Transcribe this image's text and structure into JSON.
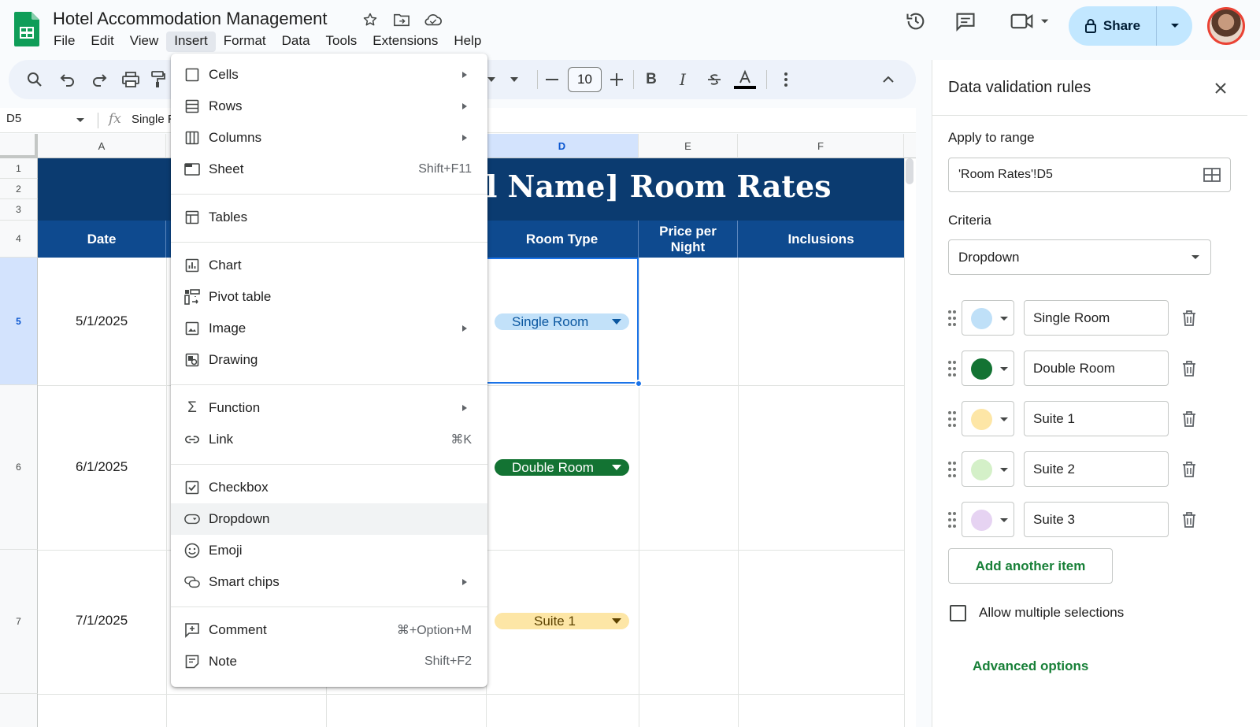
{
  "app": {
    "doc_title": "Hotel Accommodation Management",
    "menus": [
      "File",
      "Edit",
      "View",
      "Insert",
      "Format",
      "Data",
      "Tools",
      "Extensions",
      "Help"
    ],
    "active_menu": "Insert",
    "share_label": "Share"
  },
  "toolbar": {
    "font_size": "10",
    "icons": [
      "search-icon",
      "undo-icon",
      "redo-icon",
      "print-icon",
      "paint-format-icon",
      "font-size-decrease-icon",
      "font-size-increase-icon",
      "bold-icon",
      "italic-icon",
      "strikethrough-icon",
      "text-color-icon",
      "more-icon",
      "collapse-icon"
    ]
  },
  "formula_bar": {
    "cell_ref": "D5",
    "content": "Single R"
  },
  "grid": {
    "columns": [
      "A",
      "D",
      "E",
      "F"
    ],
    "selected_column": "D",
    "rows": [
      "1",
      "2",
      "3",
      "4",
      "5",
      "6",
      "7"
    ],
    "selected_row": "5",
    "title_visible": "l Name] Room Rates",
    "headers": {
      "date": "Date",
      "room_type": "Room Type",
      "price": "Price per Night",
      "inclusions": "Inclusions"
    },
    "data_rows": [
      {
        "date": "5/1/2025",
        "room_type": "Single Room",
        "chip_bg": "#c2e1f9",
        "chip_fg": "#0b57a0"
      },
      {
        "date": "6/1/2025",
        "room_type": "Double Room",
        "chip_bg": "#137333",
        "chip_fg": "#ffffff"
      },
      {
        "date": "7/1/2025",
        "room_type": "Suite 1",
        "chip_bg": "#fde6a6",
        "chip_fg": "#5c4200"
      }
    ]
  },
  "insert_menu": {
    "items": [
      {
        "label": "Cells",
        "icon": "cells-icon",
        "submenu": true
      },
      {
        "label": "Rows",
        "icon": "rows-icon",
        "submenu": true
      },
      {
        "label": "Columns",
        "icon": "columns-icon",
        "submenu": true
      },
      {
        "label": "Sheet",
        "icon": "sheet-icon",
        "shortcut": "Shift+F11"
      },
      {
        "label": "Tables",
        "icon": "tables-icon"
      },
      {
        "label": "Chart",
        "icon": "chart-icon"
      },
      {
        "label": "Pivot table",
        "icon": "pivot-table-icon"
      },
      {
        "label": "Image",
        "icon": "image-icon",
        "submenu": true
      },
      {
        "label": "Drawing",
        "icon": "drawing-icon"
      },
      {
        "label": "Function",
        "icon": "function-icon",
        "submenu": true
      },
      {
        "label": "Link",
        "icon": "link-icon",
        "shortcut": "⌘K"
      },
      {
        "label": "Checkbox",
        "icon": "checkbox-icon"
      },
      {
        "label": "Dropdown",
        "icon": "dropdown-icon",
        "highlighted": true
      },
      {
        "label": "Emoji",
        "icon": "emoji-icon"
      },
      {
        "label": "Smart chips",
        "icon": "smart-chips-icon",
        "submenu": true
      },
      {
        "label": "Comment",
        "icon": "comment-icon",
        "shortcut": "⌘+Option+M"
      },
      {
        "label": "Note",
        "icon": "note-icon",
        "shortcut": "Shift+F2"
      }
    ]
  },
  "panel": {
    "title": "Data validation rules",
    "apply_label": "Apply to range",
    "range_value": "'Room Rates'!D5",
    "criteria_label": "Criteria",
    "criteria_value": "Dropdown",
    "options": [
      {
        "value": "Single Room",
        "color": "#bfe0f8"
      },
      {
        "value": "Double Room",
        "color": "#137333"
      },
      {
        "value": "Suite 1",
        "color": "#fde6a6"
      },
      {
        "value": "Suite 2",
        "color": "#d4f0c8"
      },
      {
        "value": "Suite 3",
        "color": "#e6d3f2"
      }
    ],
    "add_item_label": "Add another item",
    "allow_multiple_label": "Allow multiple selections",
    "allow_multiple_checked": false,
    "advanced_label": "Advanced options"
  }
}
